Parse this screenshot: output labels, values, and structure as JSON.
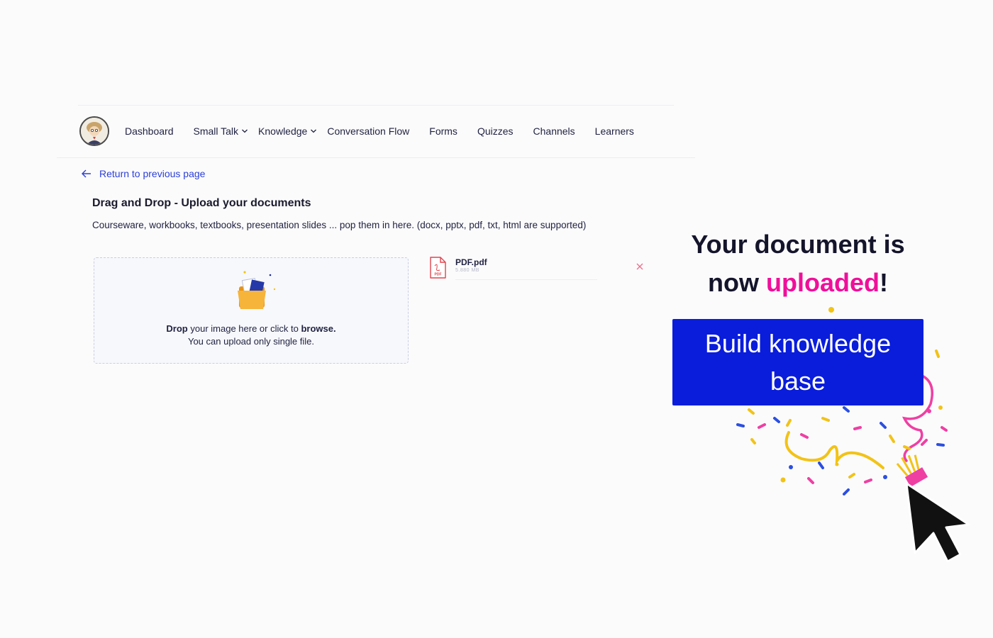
{
  "nav": {
    "items": [
      {
        "label": "Dashboard"
      },
      {
        "label": "Small Talk"
      },
      {
        "label": "Knowledge"
      },
      {
        "label": "Conversation Flow"
      },
      {
        "label": "Forms"
      },
      {
        "label": "Quizzes"
      },
      {
        "label": "Channels"
      },
      {
        "label": "Learners"
      }
    ]
  },
  "back_link": "Return to previous page",
  "upload": {
    "title": "Drag and Drop - Upload your documents",
    "description": "Courseware, workbooks, textbooks, presentation slides ... pop them in here. (docx, pptx, pdf, txt, html are supported)",
    "dropzone": {
      "drop_word": "Drop",
      "text_middle": " your image here or click to ",
      "browse_word": "browse.",
      "line2": "You can upload only single file."
    },
    "file": {
      "name": "PDF.pdf",
      "size": "5.880 MB",
      "icon_label": "PDF"
    }
  },
  "promo": {
    "headline_part1": "Your document is",
    "headline_part2a": "now ",
    "headline_accent": "uploaded",
    "headline_part2b": "!",
    "cta_line1": "Build knowledge",
    "cta_line2": "base"
  },
  "colors": {
    "accent_blue": "#0a1ddb",
    "link_blue": "#2b3fd8",
    "accent_pink": "#ef0f9a",
    "confetti_yellow": "#f2c317",
    "folder_orange": "#f6a623",
    "pdf_red": "#e2434b"
  },
  "icons": [
    "avatar",
    "chevron-down-icon",
    "arrow-left-icon",
    "folder-upload-icon",
    "pdf-file-icon",
    "close-icon",
    "confetti-illustration",
    "mouse-cursor-icon"
  ]
}
